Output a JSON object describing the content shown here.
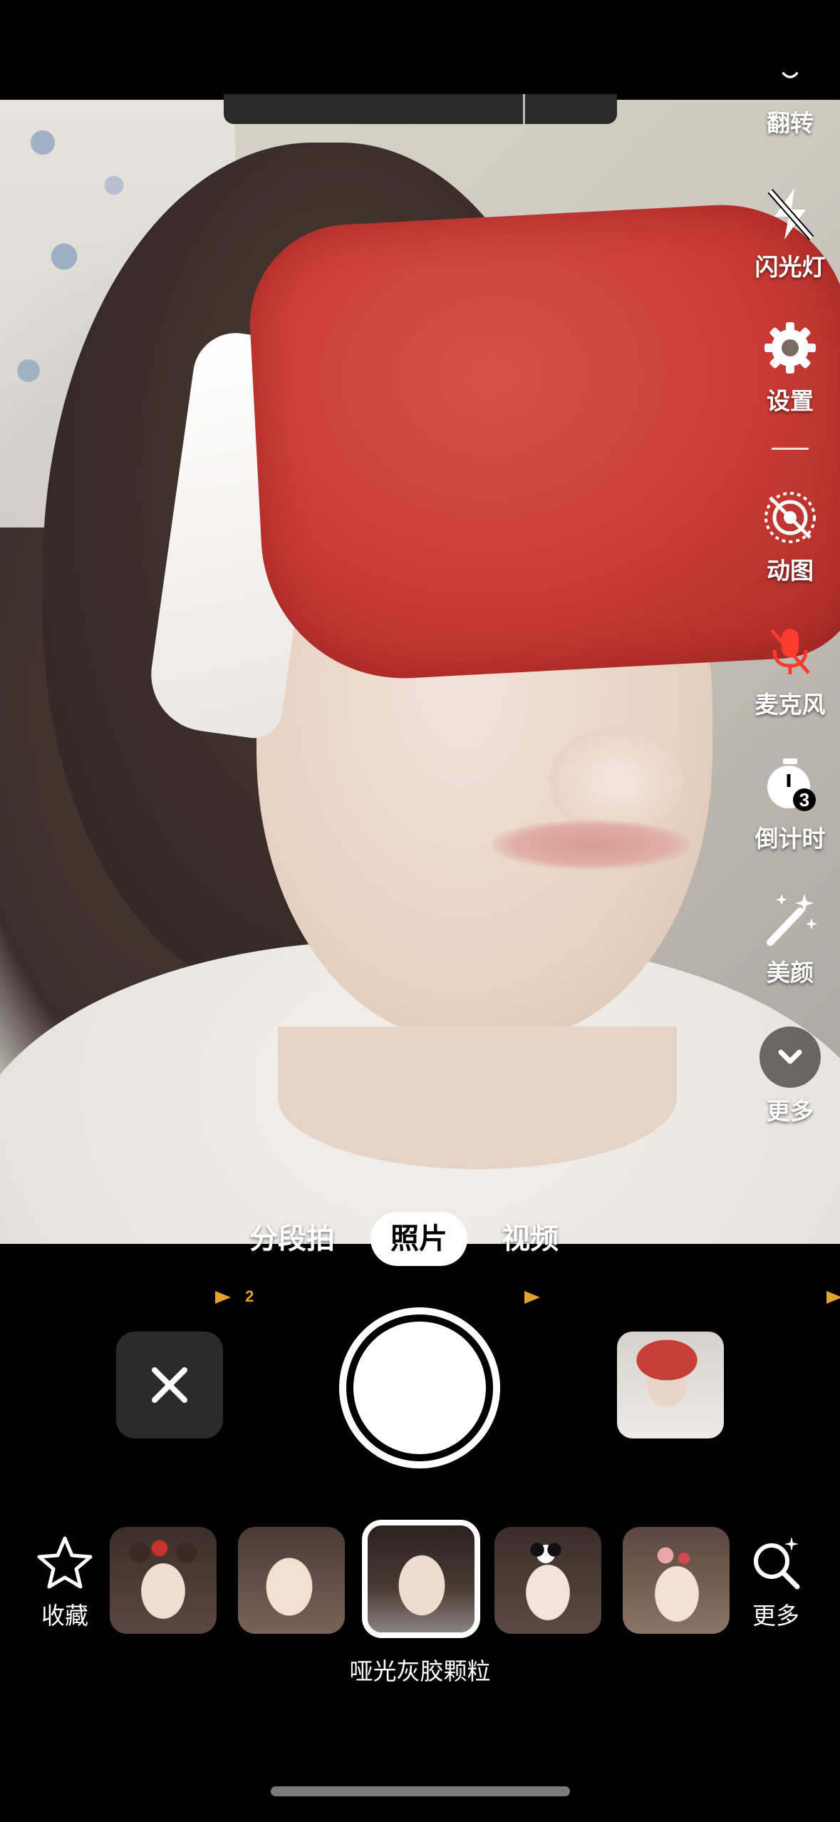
{
  "toolbar": {
    "items": [
      {
        "label": "翻转",
        "icon": "flip-camera-icon"
      },
      {
        "label": "闪光灯",
        "icon": "flash-off-icon"
      },
      {
        "label": "设置",
        "icon": "gear-icon"
      },
      {
        "label": "动图",
        "icon": "live-photo-off-icon"
      },
      {
        "label": "麦克风",
        "icon": "mic-off-icon"
      },
      {
        "label": "倒计时",
        "icon": "timer-icon",
        "badge": "3"
      },
      {
        "label": "美颜",
        "icon": "beauty-wand-icon"
      },
      {
        "label": "更多",
        "icon": "chevron-down-icon"
      }
    ]
  },
  "modes": {
    "segment": "分段拍",
    "photo": "照片",
    "video": "视频",
    "active": "照片"
  },
  "hint": {
    "count": "2"
  },
  "effects": {
    "favorite_label": "收藏",
    "more_label": "更多",
    "selected_name": "哑光灰胶颗粒",
    "thumbs": [
      "bear-ears-filter",
      "natural-filter",
      "matte-grain-filter",
      "panda-filter",
      "bunny-filter"
    ]
  },
  "colors": {
    "accent_active": "#ffffff",
    "mic_off": "#ff3b30",
    "hint": "#e1a22f"
  }
}
